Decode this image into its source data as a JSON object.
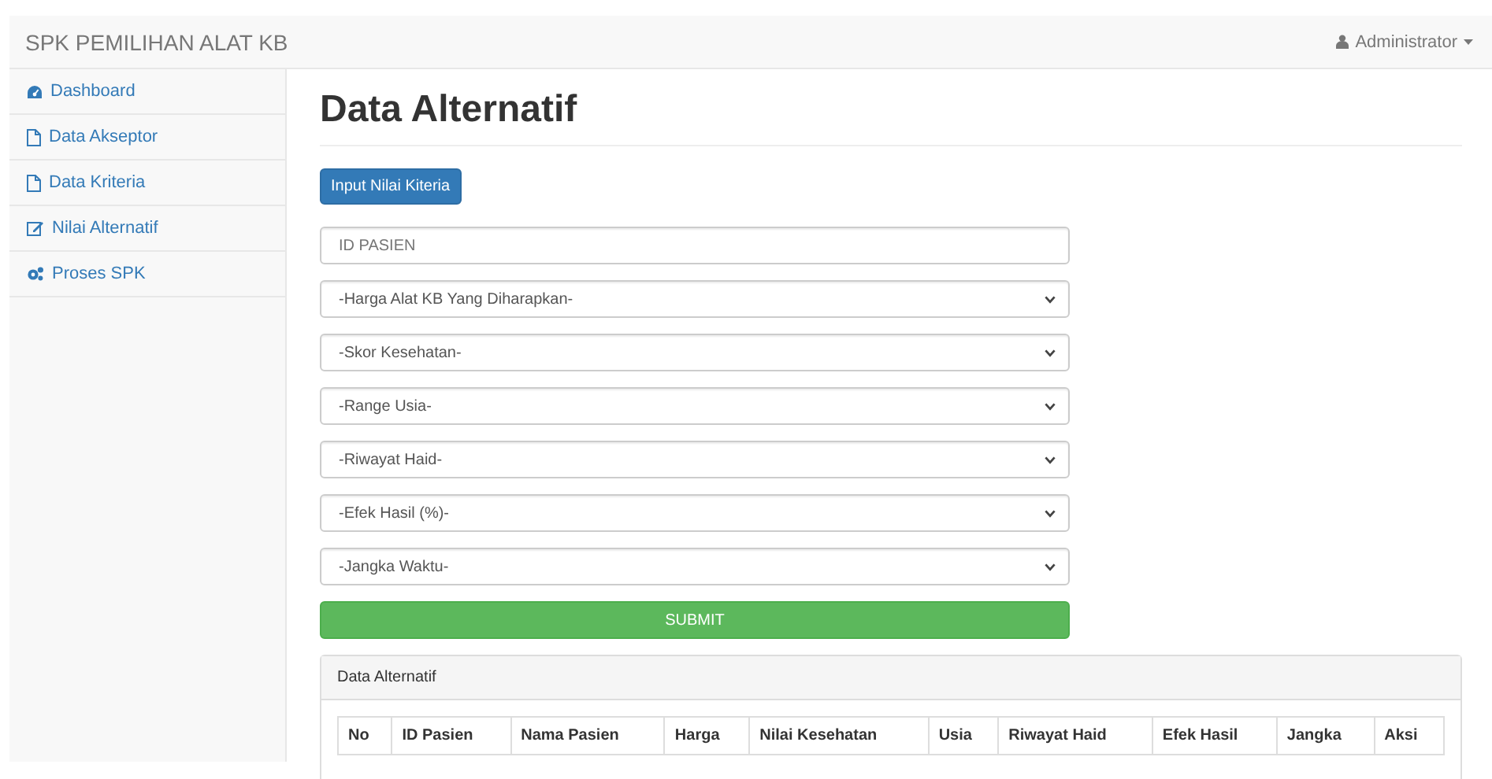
{
  "navbar": {
    "brand": "SPK PEMILIHAN ALAT KB",
    "user": "Administrator"
  },
  "sidebar": {
    "items": [
      {
        "label": "Dashboard",
        "kind": "dashboard"
      },
      {
        "label": "Data Akseptor",
        "kind": "file"
      },
      {
        "label": "Data Kriteria",
        "kind": "file"
      },
      {
        "label": "Nilai Alternatif",
        "kind": "edit"
      },
      {
        "label": "Proses SPK",
        "kind": "gears"
      }
    ]
  },
  "page": {
    "title": "Data Alternatif",
    "action_button": "Input Nilai Kiteria"
  },
  "form": {
    "fields": [
      {
        "kind": "text",
        "placeholder": "ID PASIEN"
      },
      {
        "kind": "select",
        "value": "-Harga Alat KB Yang Diharapkan-"
      },
      {
        "kind": "select",
        "value": "-Skor Kesehatan-"
      },
      {
        "kind": "select",
        "value": "-Range Usia-"
      },
      {
        "kind": "select",
        "value": "-Riwayat Haid-"
      },
      {
        "kind": "select",
        "value": "-Efek Hasil (%)-"
      },
      {
        "kind": "select",
        "value": "-Jangka Waktu-"
      }
    ],
    "submit": "SUBMIT"
  },
  "panel": {
    "heading": "Data Alternatif",
    "table": {
      "columns": [
        "No",
        "ID Pasien",
        "Nama Pasien",
        "Harga",
        "Nilai Kesehatan",
        "Usia",
        "Riwayat Haid",
        "Efek Hasil",
        "Jangka",
        "Aksi"
      ]
    }
  }
}
